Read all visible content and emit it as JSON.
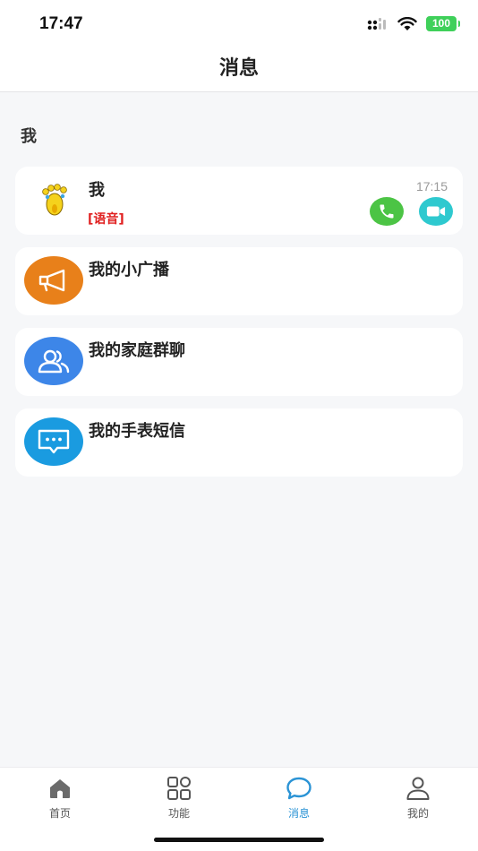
{
  "status_bar": {
    "time": "17:47",
    "battery": "100"
  },
  "header": {
    "title": "消息"
  },
  "section": {
    "label": "我"
  },
  "contact": {
    "name": "我",
    "time": "17:15",
    "last_message": "[语音]",
    "avatar_icon": "footprint-icon"
  },
  "items": [
    {
      "title": "我的小广播",
      "icon": "megaphone-icon",
      "color": "#e8801a"
    },
    {
      "title": "我的家庭群聊",
      "icon": "group-icon",
      "color": "#3d86e8"
    },
    {
      "title": "我的手表短信",
      "icon": "chat-bubble-icon",
      "color": "#1a9be0"
    }
  ],
  "tabs": [
    {
      "label": "首页",
      "icon": "home-icon"
    },
    {
      "label": "功能",
      "icon": "grid-icon"
    },
    {
      "label": "消息",
      "icon": "message-icon",
      "active": true
    },
    {
      "label": "我的",
      "icon": "profile-icon"
    }
  ],
  "colors": {
    "accent": "#2a93d5",
    "voice_tag": "#e02020",
    "phone_button": "#4cc445",
    "video_button": "#2ec9cf"
  }
}
